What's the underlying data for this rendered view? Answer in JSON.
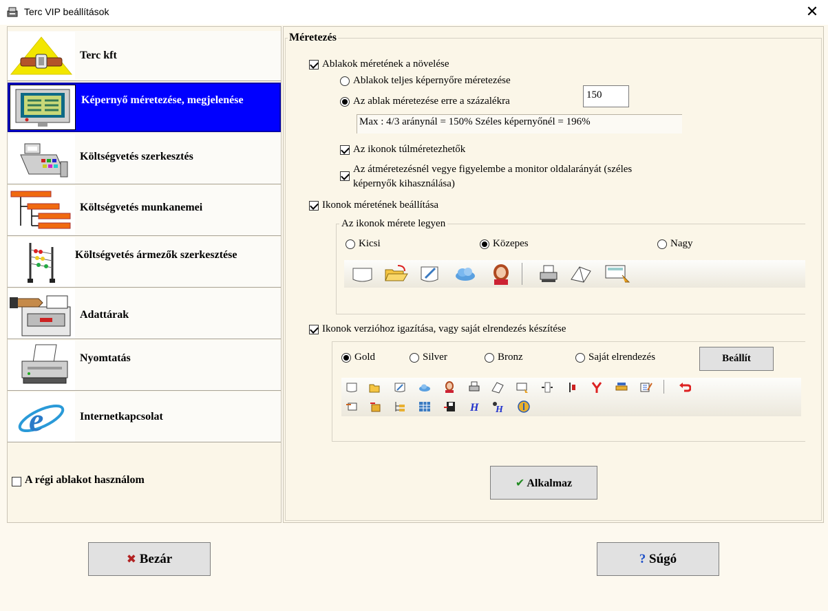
{
  "window": {
    "title": "Terc VIP beállítások"
  },
  "nav": {
    "items": [
      {
        "label": "Terc kft",
        "icon": "terc-logo-icon"
      },
      {
        "label": "Képernyő méretezése, megjelenése",
        "icon": "monitor-icon"
      },
      {
        "label": "Költségvetés szerkesztés",
        "icon": "cash-register-icon"
      },
      {
        "label": "Költségvetés munkanemei",
        "icon": "tree-structure-icon"
      },
      {
        "label": "Költségvetés ármezők szerkesztése",
        "icon": "abacus-icon"
      },
      {
        "label": "Adattárak",
        "icon": "archive-icon"
      },
      {
        "label": "Nyomtatás",
        "icon": "printer-icon"
      },
      {
        "label": "Internetkapcsolat",
        "icon": "internet-explorer-icon"
      }
    ],
    "selected_index": 1,
    "old_window_label": "A régi ablakot használom",
    "old_window_checked": false
  },
  "sizing": {
    "group_title": "Méretezés",
    "increase_windows_label": "Ablakok méretének a növelése",
    "increase_windows_checked": true,
    "full_screen_label": "Ablakok teljes képernyőre méretezése",
    "percent_label": "Az ablak méretezése erre a százalékra",
    "percent_value": "150",
    "info_text": "Max : 4/3 aránynál = 150%  Széles képernyőnél = 196%",
    "icons_oversize_label": "Az ikonok túlméretezhetők",
    "icons_oversize_checked": true,
    "aspect_label_line1": "Az átméretezésnél vegye figyelembe a monitor oldalarányát (széles",
    "aspect_label_line2": "képernyők kihasználása)",
    "aspect_checked": true,
    "icon_size_setting_label": "Ikonok méretének beállítása",
    "icon_size_setting_checked": true,
    "icon_size_group_title": "Az ikonok mérete legyen",
    "size_options": [
      "Kicsi",
      "Közepes",
      "Nagy"
    ],
    "size_selected": "Közepes",
    "version_label": "Ikonok verzióhoz igazítása, vagy saját elrendezés készítése",
    "version_checked": true,
    "version_options": [
      "Gold",
      "Silver",
      "Bronz",
      "Saját elrendezés"
    ],
    "version_selected": "Gold",
    "settings_button": "Beállít",
    "apply_button": "Alkalmaz"
  },
  "footer": {
    "close_button": "Bezár",
    "help_button": "Súgó"
  },
  "colors": {
    "selected_nav_bg": "#0000ff",
    "background": "#fdf9ef",
    "apply_check": "#228b22",
    "close_x": "#b22222",
    "help_q": "#1e50c8"
  }
}
